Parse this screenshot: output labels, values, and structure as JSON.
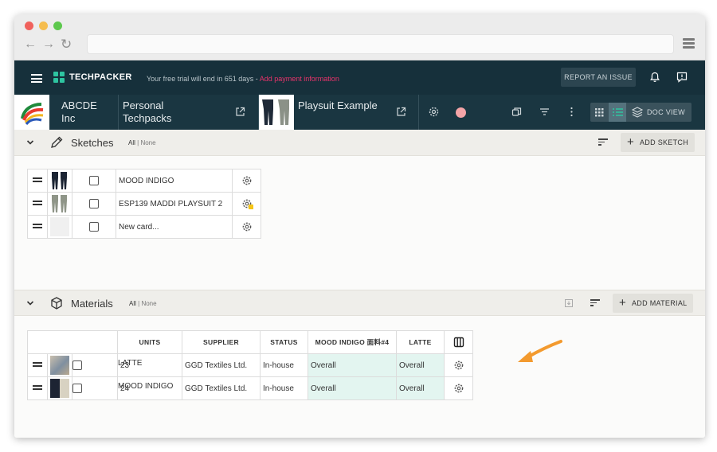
{
  "app": {
    "brand": "TECHPACKER",
    "trial_text": "Your free trial will end in 651 days",
    "trial_sep": " - ",
    "trial_link": "Add payment information",
    "report_label": "REPORT AN ISSUE",
    "company": "ABCDE Inc",
    "folder": "Personal Techpacks",
    "style": "Playsuit Example",
    "doc_view_label": "DOC VIEW",
    "status_color": "#f4a4a7",
    "accent_color": "#2ec4a0",
    "link_color": "#e8336b"
  },
  "sketches": {
    "title": "Sketches",
    "filter_all": "All",
    "filter_sep": "|",
    "filter_none": "None",
    "add_label": "ADD SKETCH",
    "rows": [
      {
        "label": "MOOD INDIGO",
        "thumb": "navy-playsuit",
        "has_badge": false
      },
      {
        "label": "ESP139 MADDI PLAYSUIT 2",
        "thumb": "olive-playsuit",
        "has_badge": true
      },
      {
        "label": "New card...",
        "thumb": "empty",
        "has_badge": false
      }
    ]
  },
  "materials": {
    "title": "Materials",
    "filter_all": "All",
    "filter_sep": "|",
    "filter_none": "None",
    "add_label": "ADD MATERIAL",
    "columns": [
      "UNITS",
      "SUPPLIER",
      "STATUS",
      "MOOD INDIGO 面料#4",
      "LATTE"
    ],
    "rows": [
      {
        "name": "LATTE",
        "units": "23",
        "supplier": "GGD Textiles Ltd.",
        "status": "In-house",
        "col_mood": "Overall",
        "col_latte": "Overall"
      },
      {
        "name": "MOOD INDIGO",
        "units": "24",
        "supplier": "GGD Textiles Ltd.",
        "status": "In-house",
        "col_mood": "Overall",
        "col_latte": "Overall"
      }
    ]
  },
  "annotation": {
    "arrow_color": "#f39a2e"
  }
}
